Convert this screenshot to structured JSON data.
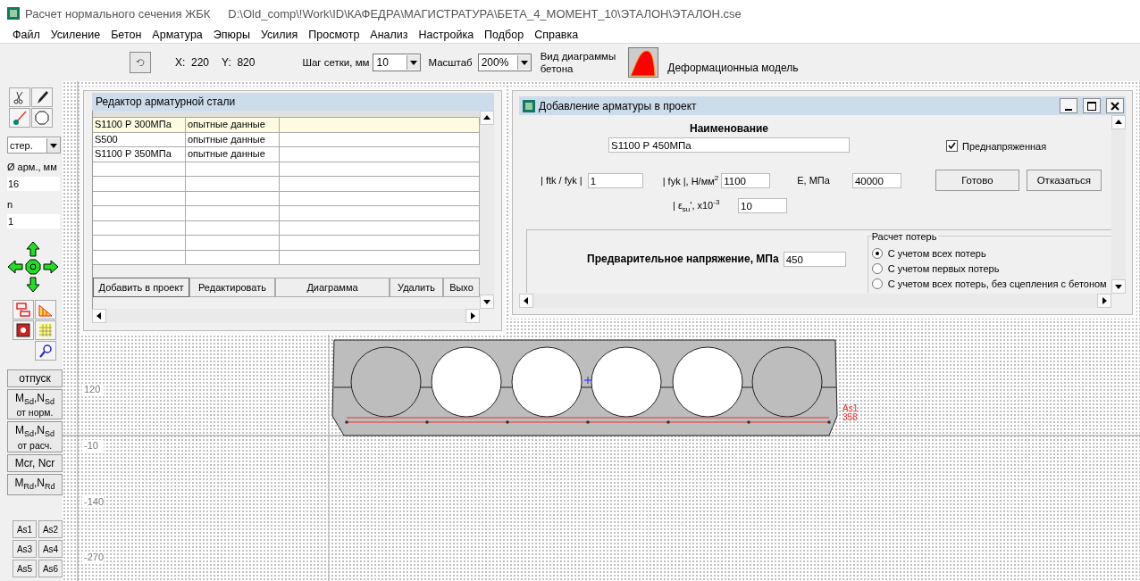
{
  "window": {
    "title": "Расчет нормального сечения ЖБК",
    "path": "D:\\Old_comp\\!Work\\ID\\КАФЕДРА\\МАГИСТРАТУРА\\БЕТА_4_МОМЕНТ_10\\ЭТАЛОН\\ЭТАЛОН.cse"
  },
  "menu": [
    "Файл",
    "Усиление",
    "Бетон",
    "Арматура",
    "Эпюры",
    "Усилия",
    "Просмотр",
    "Анализ",
    "Настройка",
    "Подбор",
    "Справка"
  ],
  "toolbar": {
    "coords": [
      {
        "label": "X:",
        "value": "220"
      },
      {
        "label": "Y:",
        "value": "820"
      }
    ],
    "grid_step": {
      "label": "Шаг сетки, мм",
      "value": "10"
    },
    "scale": {
      "label": "Масштаб",
      "value": "200%"
    },
    "diagram_label": [
      "Вид диаграммы",
      "бетона"
    ],
    "model": "Деформационныа модель"
  },
  "left_panel": {
    "section_type": "стер.",
    "diameter_label": "Ø арм., мм",
    "diameter": "16",
    "count_label": "n",
    "count": "1",
    "buttons": [
      {
        "kind": "plain",
        "label": "отпуск"
      },
      {
        "kind": "two_line",
        "label": "M$_{Sd}$,N$_{Sd}$",
        "sub": "от норм."
      },
      {
        "kind": "two_line",
        "label": "M$_{Sd}$,N$_{Sd}$",
        "sub": "от расч."
      },
      {
        "kind": "plain",
        "label": "Mcr, Ncr"
      },
      {
        "kind": "plain",
        "label": "M$_{Rd}$,N$_{Rd}$"
      }
    ],
    "groups": [
      "As1",
      "As2",
      "As3",
      "As4",
      "As5",
      "As6"
    ]
  },
  "canvas": {
    "axis_labels": [
      "120",
      "-10",
      "-140",
      "-270"
    ],
    "rebar_label": [
      "As1",
      "358"
    ]
  },
  "steel_editor": {
    "title": "Редактор арматурной стали",
    "rows": [
      {
        "cells": [
          "S1100 P 300МПа",
          "опытные данные"
        ],
        "selected": true
      },
      {
        "cells": [
          "S500",
          "опытные данные"
        ],
        "selected": false
      },
      {
        "cells": [
          "S1100 P 350МПа",
          "опытные данные"
        ],
        "selected": false
      }
    ],
    "buttons": [
      "Добавить в проект",
      "Редактировать",
      "Диаграмма",
      "Удалить",
      "Выхо"
    ]
  },
  "add_dialog": {
    "title": "Добавление арматуры в проект",
    "name_label": "Наименование",
    "name_value": "S1100 P 450МПа",
    "prestressed": {
      "label": "Преднапряженная",
      "checked": true
    },
    "fields": [
      {
        "label": "| ftk / fyk |",
        "value": "1"
      },
      {
        "label": "| fyk |, Н/мм$^{2}$",
        "value": "1100"
      },
      {
        "label": "E, МПа",
        "value": "40000"
      },
      {
        "label": "| ε$_{su}$', x10$^{-3}$",
        "value": "10"
      }
    ],
    "buttons": [
      "Готово",
      "Отказаться"
    ],
    "prestress": {
      "label": "Предварительное напряжение, МПа",
      "value": "450"
    },
    "losses": {
      "title": "Расчет потерь",
      "options": [
        {
          "label": "С учетом всех потерь",
          "selected": true
        },
        {
          "label": "С учетом первых потерь",
          "selected": false
        },
        {
          "label": "С учетом всех потерь, без сцепления с бетоном",
          "selected": false
        }
      ]
    }
  }
}
